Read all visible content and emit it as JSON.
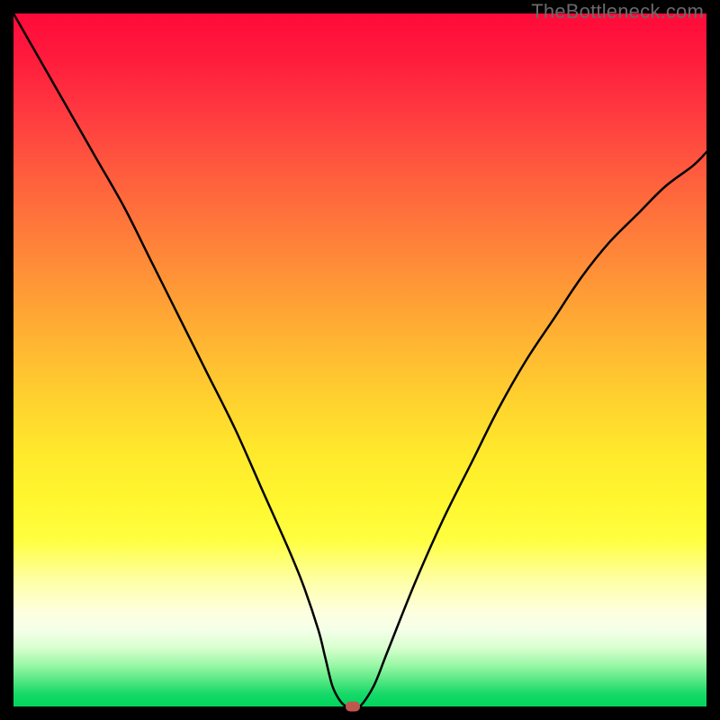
{
  "watermark": "TheBottleneck.com",
  "colors": {
    "frame": "#000000",
    "curve": "#000000",
    "marker": "#c0574e"
  },
  "chart_data": {
    "type": "line",
    "title": "",
    "xlabel": "",
    "ylabel": "",
    "xlim": [
      0,
      100
    ],
    "ylim": [
      0,
      100
    ],
    "grid": false,
    "legend": false,
    "series": [
      {
        "name": "bottleneck-curve",
        "x": [
          0,
          4,
          8,
          12,
          16,
          20,
          24,
          28,
          32,
          36,
          40,
          42,
          44,
          45,
          46,
          47,
          48,
          49,
          50,
          52,
          54,
          58,
          62,
          66,
          70,
          74,
          78,
          82,
          86,
          90,
          94,
          98,
          100
        ],
        "y": [
          100,
          93,
          86,
          79,
          72,
          64,
          56,
          48,
          40,
          31,
          22,
          17,
          11,
          7,
          3,
          1,
          0,
          0,
          0,
          3,
          8,
          18,
          27,
          35,
          43,
          50,
          56,
          62,
          67,
          71,
          75,
          78,
          80
        ]
      }
    ],
    "marker": {
      "x": 49,
      "y": 0
    },
    "gradient_stops": [
      {
        "pos": 0,
        "color": "#ff0a3a"
      },
      {
        "pos": 0.5,
        "color": "#ffd22e"
      },
      {
        "pos": 0.82,
        "color": "#feffa8"
      },
      {
        "pos": 1.0,
        "color": "#00d45e"
      }
    ]
  }
}
